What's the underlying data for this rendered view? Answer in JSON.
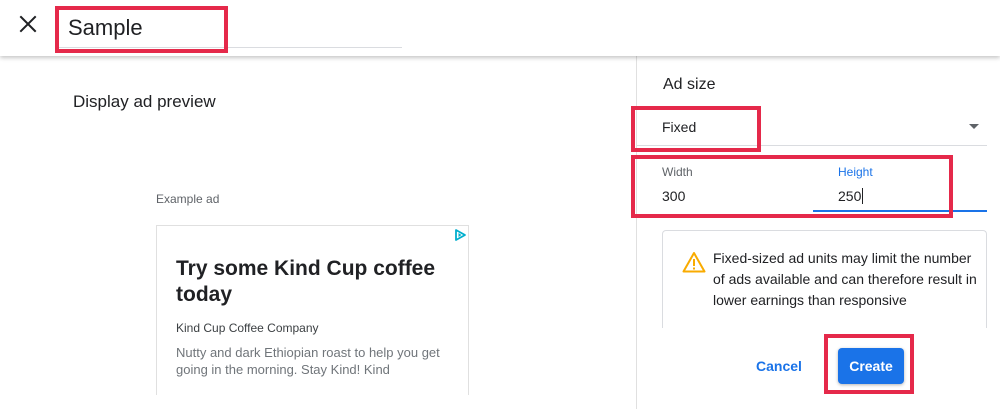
{
  "header": {
    "close_icon": "close-icon",
    "ad_unit_name": "Sample"
  },
  "preview": {
    "title": "Display ad preview",
    "example_label": "Example ad",
    "ad": {
      "headline": "Try some Kind Cup coffee today",
      "company": "Kind Cup Coffee Company",
      "description": "Nutty and dark Ethiopian roast to help you get going in the morning. Stay Kind! Kind",
      "adchoices_icon": "adchoices-icon"
    }
  },
  "settings": {
    "title": "Ad size",
    "size_type": "Fixed",
    "width_label": "Width",
    "width_value": "300",
    "height_label": "Height",
    "height_value": "250",
    "warning_icon": "warning-icon",
    "warning_text": "Fixed-sized ad units may limit the number of ads available and can therefore result in lower earnings than responsive",
    "cancel_label": "Cancel",
    "create_label": "Create"
  },
  "colors": {
    "accent": "#1a73e8",
    "highlight": "#e5294a",
    "warning": "#f9ab00"
  }
}
